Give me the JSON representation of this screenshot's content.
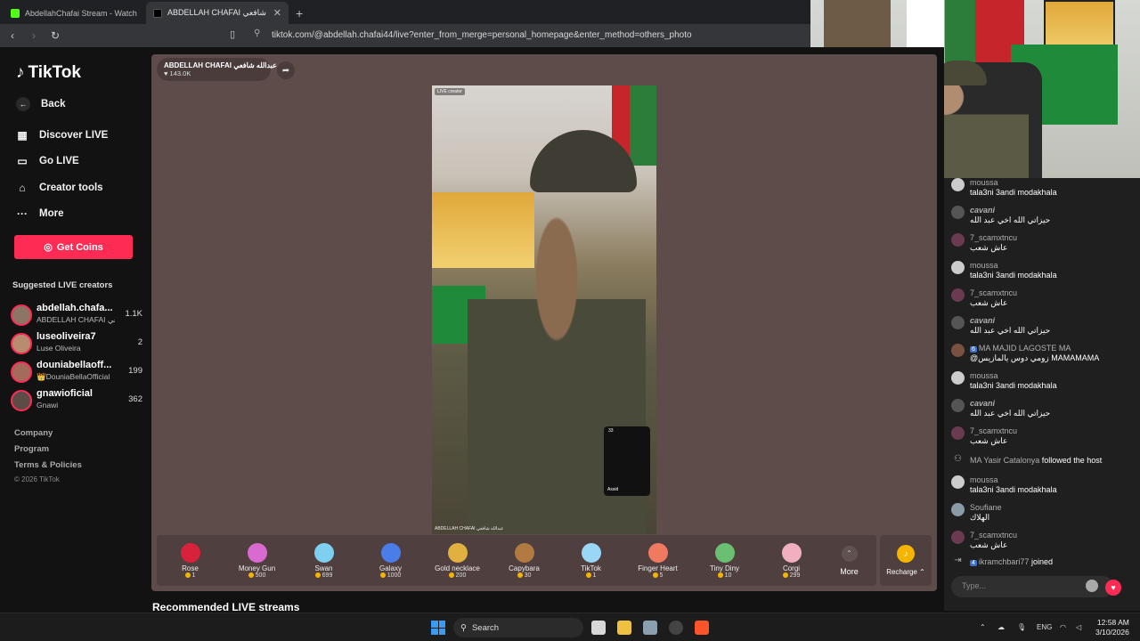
{
  "browser": {
    "tabs": [
      {
        "title": "AbdellahChafai Stream - Watch Live",
        "active": false
      },
      {
        "title": "ABDELLAH CHAFAI عبدالله شافعي",
        "active": true
      }
    ],
    "url": "tiktok.com/@abdellah.chafai44/live?enter_from_merge=personal_homepage&enter_method=others_photo"
  },
  "sidebar": {
    "logo": "TikTok",
    "back": "Back",
    "nav": [
      {
        "label": "Discover LIVE",
        "icon": "calendar-icon"
      },
      {
        "label": "Go LIVE",
        "icon": "camera-icon"
      },
      {
        "label": "Creator tools",
        "icon": "home-icon"
      },
      {
        "label": "More",
        "icon": "dots-icon"
      }
    ],
    "get_coins": "Get Coins",
    "suggested_title": "Suggested LIVE creators",
    "creators": [
      {
        "name": "abdellah.chafa...",
        "sub": "ABDELLAH CHAFAI عبدالله شافعي",
        "count": "1.1K"
      },
      {
        "name": "luseoliveira7",
        "sub": "Luse Oliveira",
        "count": "2"
      },
      {
        "name": "douniabellaoff...",
        "sub": "👑DouniaBellaOfficial",
        "count": "199"
      },
      {
        "name": "gnawioficial",
        "sub": "Gnawi",
        "count": "362"
      }
    ],
    "footer": [
      "Company",
      "Program",
      "Terms & Policies"
    ],
    "copyright": "© 2026 TikTok"
  },
  "stream": {
    "host_name": "ABDELLAH CHAFAI عبدالله شافعي",
    "host_likes": "143.0K",
    "live_tag": "LIVE creator",
    "video_caption": "ABDELLAH CHAFAI عبدالله شافعي",
    "pip_count": "33",
    "pip_label": "Assid",
    "gifts": [
      {
        "name": "Rose",
        "price": "1",
        "color": "#d8213a"
      },
      {
        "name": "Money Gun",
        "price": "500",
        "color": "#d96ad0"
      },
      {
        "name": "Swan",
        "price": "699",
        "color": "#7fd0f0"
      },
      {
        "name": "Galaxy",
        "price": "1000",
        "color": "#4a7de8"
      },
      {
        "name": "Gold necklace",
        "price": "200",
        "color": "#e0b040"
      },
      {
        "name": "Capybara",
        "price": "30",
        "color": "#b07a40"
      },
      {
        "name": "TikTok",
        "price": "1",
        "color": "#9ad6f5"
      },
      {
        "name": "Finger Heart",
        "price": "5",
        "color": "#f07a60"
      },
      {
        "name": "Tiny Diny",
        "price": "10",
        "color": "#6ac070"
      },
      {
        "name": "Corgi",
        "price": "299",
        "color": "#f0b0c0"
      }
    ],
    "more": "More",
    "recharge": "Recharge",
    "recommended": "Recommended LIVE streams"
  },
  "chat": {
    "messages": [
      {
        "user": "moussa",
        "text": "tala3ni 3andi modakhala"
      },
      {
        "user": "cavani",
        "text": "حيزاتي الله اخي عبد الله"
      },
      {
        "user": "7_scamxtncu",
        "text": "عاش شعب"
      },
      {
        "user": "moussa",
        "text": "tala3ni 3andi modakhala"
      },
      {
        "user": "7_scamxtncu",
        "text": "عاش شعب"
      },
      {
        "user": "cavani",
        "text": "حيزاتي الله اخي عبد الله"
      },
      {
        "user": "MA MAJID LAGOSTE MA",
        "text": "@زومي دوس يالمازيس MAMAMAMA",
        "badge": "6"
      },
      {
        "user": "moussa",
        "text": "tala3ni 3andi modakhala"
      },
      {
        "user": "cavani",
        "text": "حيزاتي الله اخي عبد الله"
      },
      {
        "user": "7_scamxtncu",
        "text": "عاش شعب"
      }
    ],
    "follow_event": {
      "user": "MA Yasir Catalonya",
      "action": "followed the host"
    },
    "messages2": [
      {
        "user": "moussa",
        "text": "tala3ni 3andi modakhala"
      },
      {
        "user": "Soufiane",
        "text": "الهلاك"
      },
      {
        "user": "7_scamxtncu",
        "text": "عاش شعب"
      }
    ],
    "join_event": {
      "badge": "4",
      "user": "ikramchbari77",
      "action": "joined"
    },
    "input_placeholder": "Type..."
  },
  "taskbar": {
    "search": "Search",
    "lang": "ENG",
    "time": "12:58 AM",
    "date": "3/10/2026"
  }
}
